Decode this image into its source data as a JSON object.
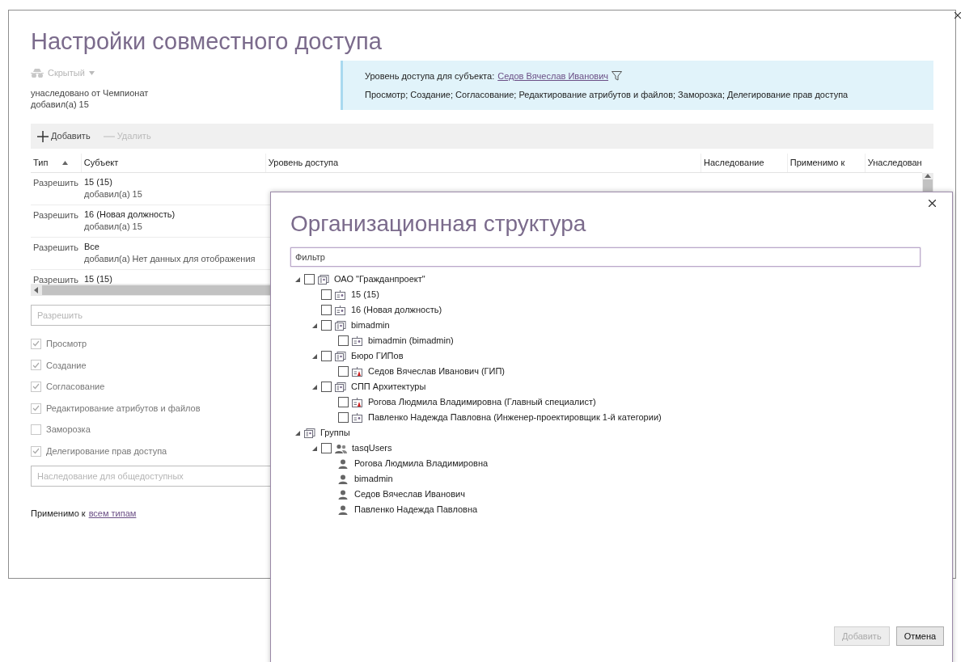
{
  "dialog": {
    "title": "Настройки совместного доступа",
    "visibility": {
      "label": "Скрытый",
      "disabled": true
    },
    "inherited_from": "унаследовано от Чемпионат",
    "added_by": "добавил(а) 15",
    "info": {
      "prefix": "Уровень доступа для субъекта:",
      "subject_link": "Седов Вячеслав Иванович",
      "permissions": "Просмотр; Создание; Согласование; Редактирование атрибутов и файлов; Заморозка; Делегирование прав доступа"
    },
    "toolbar": [
      {
        "label": "Добавить",
        "kind": "add",
        "disabled": false
      },
      {
        "label": "Удалить",
        "kind": "remove",
        "disabled": true
      }
    ],
    "table": {
      "columns": [
        "Тип",
        "Субъект",
        "Уровень доступа",
        "Наследование",
        "Применимо к",
        "Унаследован"
      ],
      "rows": [
        {
          "type": "Разрешить",
          "subject": "15 (15)",
          "added_by": "добавил(а) 15"
        },
        {
          "type": "Разрешить",
          "subject": "16 (Новая должность)",
          "added_by": "добавил(а) 15"
        },
        {
          "type": "Разрешить",
          "subject": "Все",
          "added_by": "добавил(а) Нет данных для отображения"
        },
        {
          "type": "Разрешить",
          "subject": "15 (15)"
        }
      ]
    },
    "rule_field": {
      "placeholder": "Разрешить"
    },
    "permissions": [
      {
        "label": "Просмотр",
        "checked": true
      },
      {
        "label": "Создание",
        "checked": true
      },
      {
        "label": "Согласование",
        "checked": true
      },
      {
        "label": "Редактирование атрибутов и файлов",
        "checked": true
      },
      {
        "label": "Заморозка",
        "checked": false
      },
      {
        "label": "Делегирование прав доступа",
        "checked": true
      }
    ],
    "inheritance_field": {
      "placeholder": "Наследование для общедоступных"
    },
    "applies_to": {
      "label": "Применимо к",
      "link": "всем типам"
    }
  },
  "org_dialog": {
    "title": "Организационная структура",
    "filter": {
      "placeholder": "Фильтр"
    },
    "tree": [
      {
        "label": "ОАО \"Гражданпроект\"",
        "kind": "org",
        "checked": false,
        "expanded": true,
        "children": [
          {
            "label": "15 (15)",
            "kind": "position",
            "checked": false
          },
          {
            "label": "16 (Новая должность)",
            "kind": "position",
            "checked": false
          },
          {
            "label": "bimadmin",
            "kind": "org",
            "checked": false,
            "expanded": true,
            "children": [
              {
                "label": "bimadmin (bimadmin)",
                "kind": "position",
                "checked": false
              }
            ]
          },
          {
            "label": "Бюро ГИПов",
            "kind": "org",
            "checked": false,
            "expanded": true,
            "children": [
              {
                "label": "Седов Вячеслав Иванович (ГИП)",
                "kind": "head",
                "checked": false
              }
            ]
          },
          {
            "label": "СПП Архитектуры",
            "kind": "org",
            "checked": false,
            "expanded": true,
            "children": [
              {
                "label": "Рогова Людмила Владимировна (Главный специалист)",
                "kind": "head",
                "checked": false
              },
              {
                "label": "Павленко Надежда Павловна (Инженер-проектировщик 1-й категории)",
                "kind": "position",
                "checked": false
              }
            ]
          }
        ]
      },
      {
        "label": "Группы",
        "kind": "org",
        "expanded": true,
        "children": [
          {
            "label": "tasqUsers",
            "kind": "group",
            "checked": false,
            "expanded": true,
            "children": [
              {
                "label": "Рогова Людмила Владимировна",
                "kind": "user"
              },
              {
                "label": "bimadmin",
                "kind": "user"
              },
              {
                "label": "Седов Вячеслав Иванович",
                "kind": "user"
              },
              {
                "label": "Павленко Надежда Павловна",
                "kind": "user"
              }
            ]
          }
        ]
      }
    ],
    "buttons": [
      {
        "label": "Добавить",
        "disabled": true
      },
      {
        "label": "Отмена",
        "disabled": false
      }
    ]
  }
}
